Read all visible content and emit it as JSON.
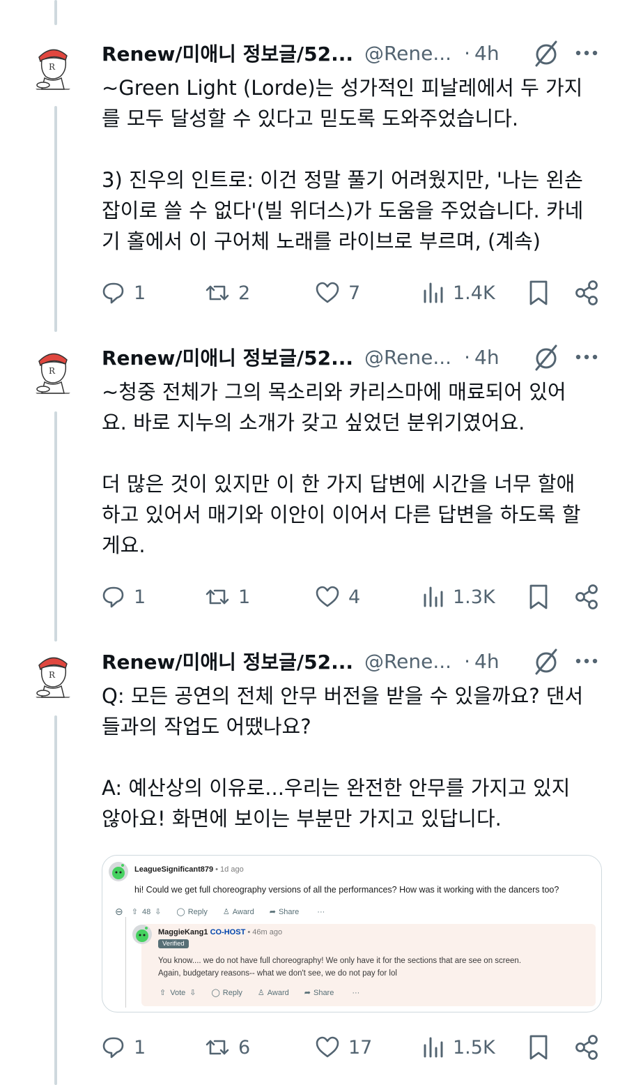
{
  "tweets": [
    {
      "author": "Renew/미애니 정보글/52...",
      "handle": "@Rene...",
      "dot": "·",
      "time": "4h",
      "text": "~Green Light (Lorde)는 성가적인 피날레에서 두 가지\n를 모두 달성할 수 있다고 믿도록 도와주었습니다.\n\n3) 진우의 인트로: 이건 정말 풀기 어려웠지만, '나는 왼손\n잡이로 쓸 수 없다'(빌 위더스)가 도움을 주었습니다. 카네\n기 홀에서 이 구어체 노래를 라이브로 부르며, (계속)",
      "replies": "1",
      "reposts": "2",
      "likes": "7",
      "views": "1.4K"
    },
    {
      "author": "Renew/미애니 정보글/52...",
      "handle": "@Rene...",
      "dot": "·",
      "time": "4h",
      "text": "~청중 전체가 그의 목소리와 카리스마에 매료되어 있어\n요. 바로 지누의 소개가 갖고 싶었던 분위기였어요.\n\n더 많은 것이 있지만 이 한 가지 답변에 시간을 너무 할애\n하고 있어서 매기와 이안이 이어서 다른 답변을 하도록 할\n게요.",
      "replies": "1",
      "reposts": "1",
      "likes": "4",
      "views": "1.3K"
    },
    {
      "author": "Renew/미애니 정보글/52...",
      "handle": "@Rene...",
      "dot": "·",
      "time": "4h",
      "text": "Q: 모든 공연의 전체 안무 버전을 받을 수 있을까요? 댄서\n들과의 작업도 어땠나요?\n\nA: 예산상의 이유로...우리는 완전한 안무를 가지고 있지\n않아요! 화면에 보이는 부분만 가지고 있답니다.",
      "replies": "1",
      "reposts": "6",
      "likes": "17",
      "views": "1.5K"
    }
  ],
  "embed": {
    "user1": "LeagueSignificant879",
    "user1_age": " • 1d ago",
    "question": "hi! Could we get full choreography versions of all the performances? How was it working with the dancers too?",
    "votes1": "48",
    "reply_label": "Reply",
    "award_label": "Award",
    "share_label": "Share",
    "more_label": "···",
    "user2": "MaggieKang1",
    "cohost": "CO-HOST",
    "user2_age": " • 46m ago",
    "verified": "Verified",
    "answer": "You know.... we do not have full choreography! We only have it for the sections that are see on screen.\nAgain, budgetary reasons-- what we don't see, we do not pay for lol",
    "vote_label": "Vote",
    "collapse": "⊖"
  }
}
